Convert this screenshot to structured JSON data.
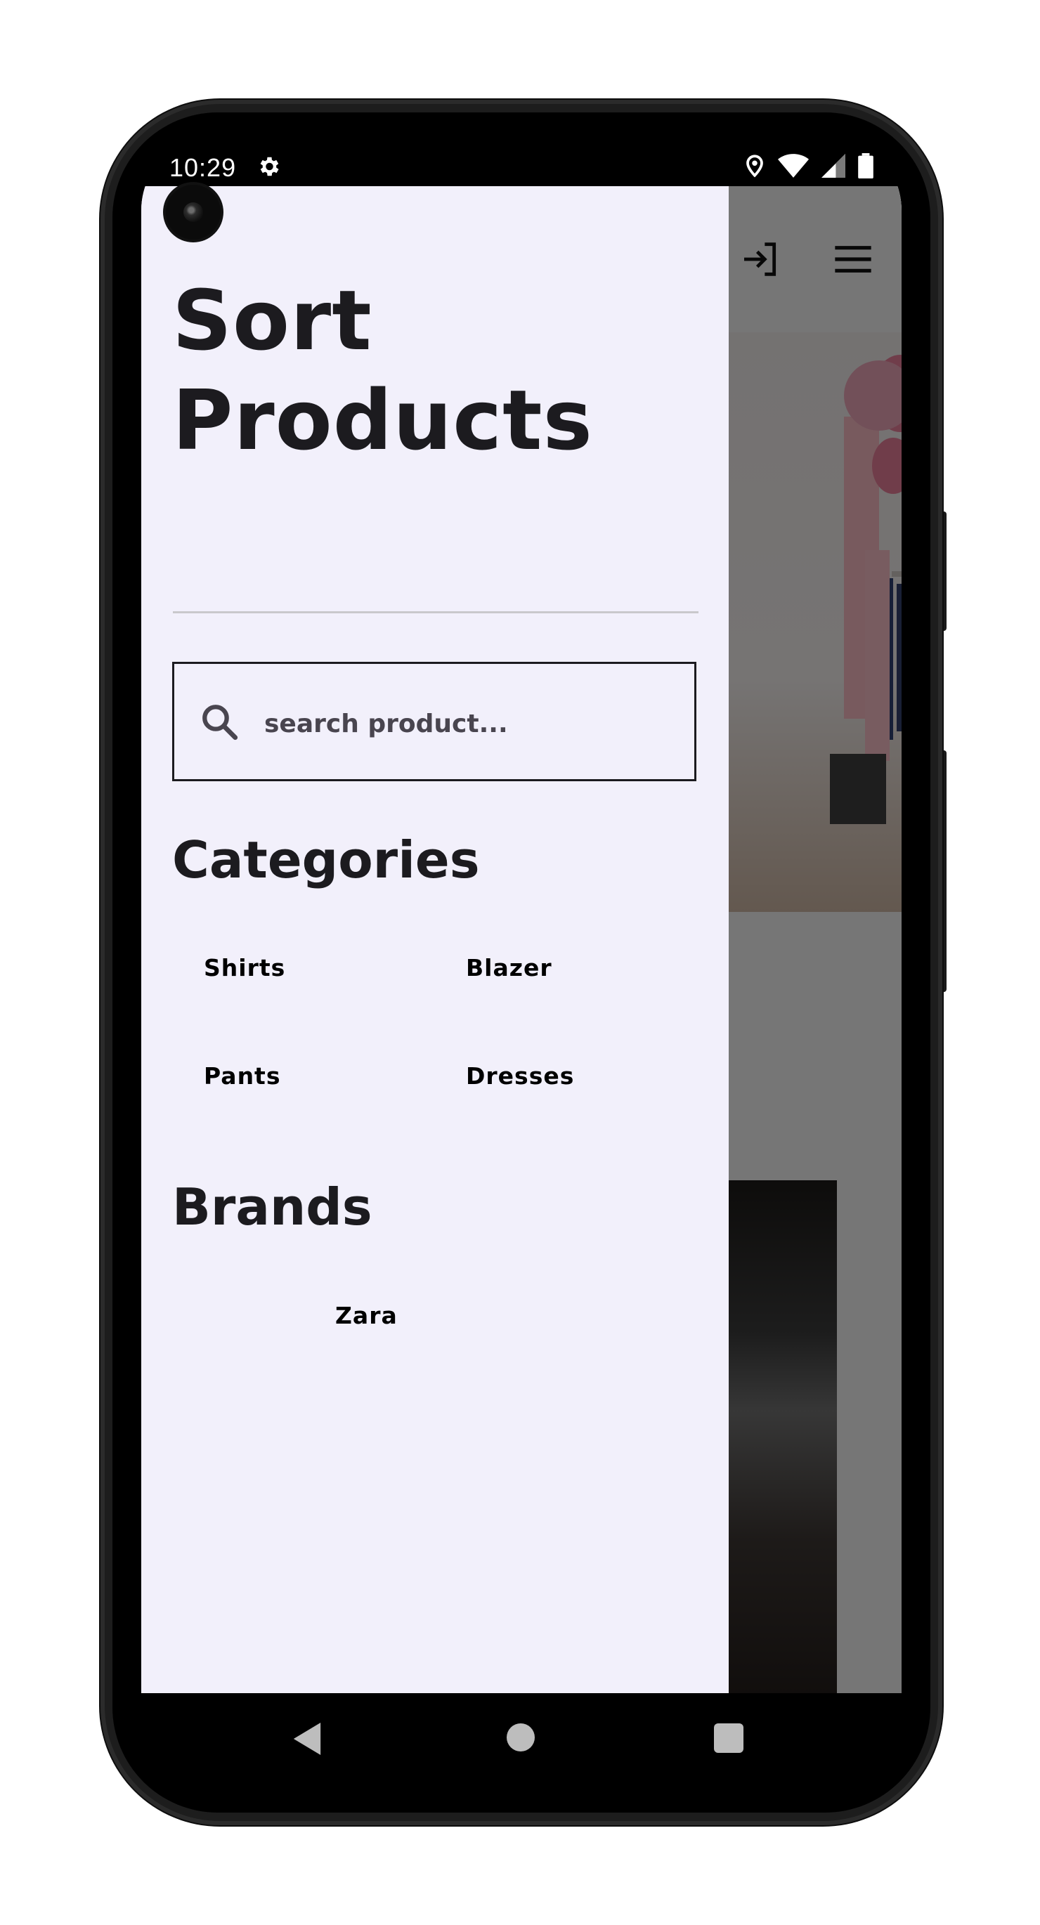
{
  "status_bar": {
    "time": "10:29",
    "icons": [
      "gear-icon",
      "location-icon",
      "wifi-icon",
      "signal-icon",
      "battery-icon"
    ]
  },
  "app_header": {
    "icons": [
      "login-icon",
      "menu-icon"
    ]
  },
  "drawer": {
    "title": "Sort Products",
    "search": {
      "placeholder": "search product...",
      "value": ""
    },
    "categories": {
      "heading": "Categories",
      "items": [
        "Shirts",
        "Blazer",
        "Pants",
        "Dresses"
      ]
    },
    "brands": {
      "heading": "Brands",
      "items": [
        "Zara"
      ]
    }
  },
  "nav_bar": {
    "icons": [
      "back-icon",
      "home-icon",
      "recents-icon"
    ]
  },
  "colors": {
    "drawer_background": "#f2f0fb",
    "text_primary": "#1c1b1f",
    "search_text": "#49454f",
    "scrim": "rgba(0,0,0,0.5)"
  }
}
